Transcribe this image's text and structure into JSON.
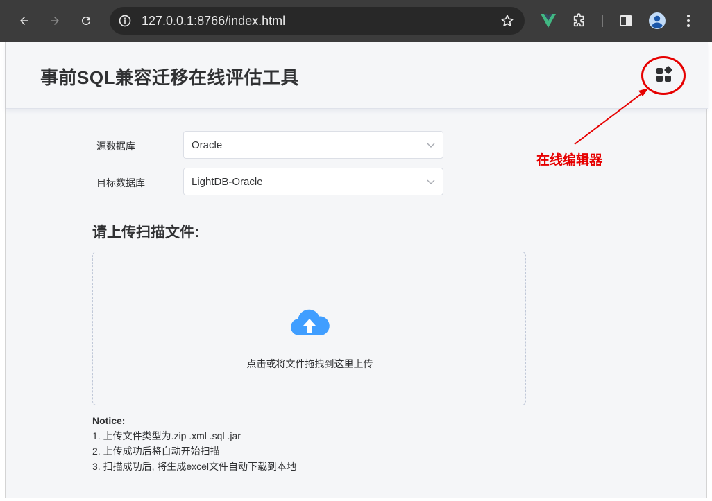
{
  "browser": {
    "url": "127.0.0.1:8766/index.html",
    "nav": {
      "back_icon": "arrow-left-icon",
      "forward_icon": "arrow-right-icon",
      "reload_icon": "reload-icon"
    },
    "ext_icons": [
      "vue-devtools-icon",
      "extensions-puzzle-icon",
      "side-panel-icon",
      "profile-avatar-icon",
      "kebab-menu-icon"
    ],
    "vue_color": "#41b883"
  },
  "header": {
    "title": "事前SQL兼容迁移在线评估工具",
    "editor_icon": "widgets-icon"
  },
  "annotation": {
    "label": "在线编辑器",
    "color": "#e60000"
  },
  "form": {
    "source": {
      "label": "源数据库",
      "value": "Oracle"
    },
    "target": {
      "label": "目标数据库",
      "value": "LightDB-Oracle"
    }
  },
  "upload": {
    "section_title": "请上传扫描文件:",
    "hint": "点击或将文件拖拽到这里上传",
    "icon": "cloud-upload-icon",
    "accent": "#409eff"
  },
  "notice": {
    "title": "Notice:",
    "items": [
      "1. 上传文件类型为.zip .xml .sql .jar",
      "2. 上传成功后将自动开始扫描",
      "3. 扫描成功后, 将生成excel文件自动下载到本地"
    ]
  }
}
